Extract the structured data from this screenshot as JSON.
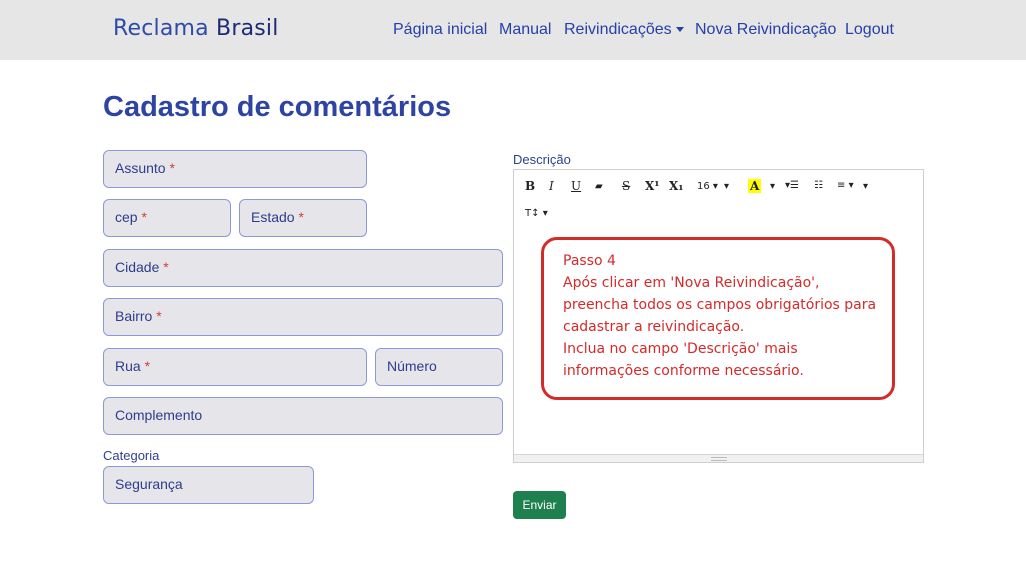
{
  "brand": {
    "part1": "Reclama",
    "part2": "Brasil"
  },
  "nav": {
    "home": "Página inicial",
    "manual": "Manual",
    "claims": "Reivindicações",
    "new_claim": "Nova Reivindicação",
    "logout": "Logout"
  },
  "page": {
    "title": "Cadastro de comentários"
  },
  "form": {
    "assunto": "Assunto",
    "cep": "cep",
    "estado": "Estado",
    "cidade": "Cidade",
    "bairro": "Bairro",
    "rua": "Rua",
    "numero": "Número",
    "complemento": "Complemento",
    "required_mark": "*",
    "categoria_label": "Categoria",
    "categoria_value": "Segurança"
  },
  "editor": {
    "label": "Descrição",
    "toolbar": {
      "bold": "B",
      "italic": "I",
      "underline": "U",
      "eraser": "▰",
      "strike": "S",
      "superscript": "X¹",
      "subscript": "X₁",
      "font_size": "16",
      "highlight": "A",
      "dropdown": "▾",
      "ul": "☰",
      "ol": "☷",
      "align": "≡",
      "text_style": "T↕"
    }
  },
  "callout": {
    "lines": [
      "Passo 4",
      "Após clicar em 'Nova Reivindicação',",
      "preencha todos os campos obrigatórios para",
      "cadastrar a reivindicação.",
      "Inclua no campo 'Descrição' mais",
      "informações conforme necessário."
    ]
  },
  "submit": {
    "label": "Enviar"
  },
  "colors": {
    "accent": "#2e44a3",
    "callout": "#d42a2a",
    "submit": "#1e7f4f"
  }
}
